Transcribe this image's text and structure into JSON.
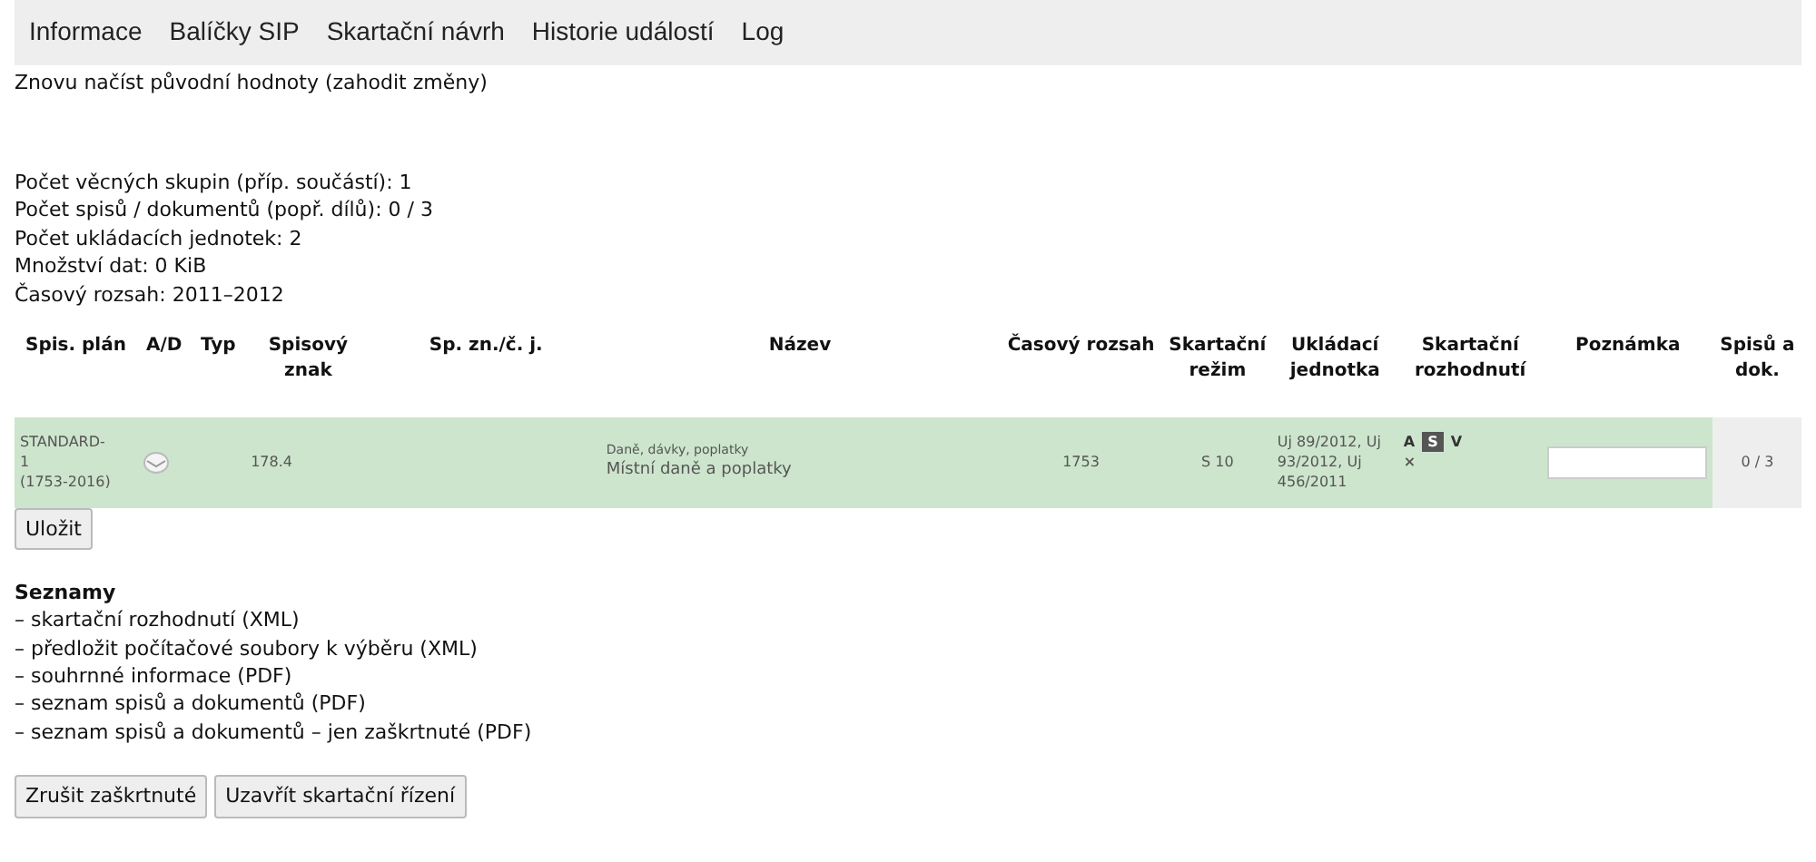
{
  "nav": [
    {
      "label": "Informace"
    },
    {
      "label": "Balíčky SIP"
    },
    {
      "label": "Skartační návrh"
    },
    {
      "label": "Historie událostí"
    },
    {
      "label": "Log"
    }
  ],
  "reload_link": "Znovu načíst původní hodnoty (zahodit změny)",
  "summary": [
    "Počet věcných skupin (příp. součástí): 1",
    "Počet spisů / dokumentů (popř. dílů): 0 / 3",
    "Počet ukládacích jednotek: 2",
    "Množství dat: 0 KiB",
    "Časový rozsah: 2011–2012"
  ],
  "table": {
    "columns": [
      "Spis. plán",
      "A/D",
      "Typ",
      "Spisový znak",
      "Sp. zn./č. j.",
      "Název",
      "Časový rozsah",
      "Skartační režim",
      "Ukládací jednotka",
      "Skartační rozhodnutí",
      "Poznámka",
      "Spisů a dok."
    ],
    "rows": [
      {
        "plan": [
          "STANDARD-",
          "1",
          "(1753-2016)"
        ],
        "spisovy_znak": "178.4",
        "nazev": [
          "Daně, dávky, poplatky",
          "Místní daně a poplatky"
        ],
        "casovy_rozsah": "1753",
        "rezim": "S 10",
        "jednotka": "Uj 89/2012, Uj 93/2012, Uj 456/2011",
        "decision": [
          {
            "label": "A",
            "selected": false
          },
          {
            "label": "S",
            "selected": true
          },
          {
            "label": "V",
            "selected": false
          }
        ],
        "remove": "×",
        "count": "0 / 3"
      }
    ]
  },
  "save_button": "Uložit",
  "lists_title": "Seznamy",
  "lists": [
    "– skartační rozhodnutí (XML)",
    "– předložit počítačové soubory k výběru (XML)",
    "– souhrnné informace (PDF)",
    "– seznam spisů a dokumentů (PDF)",
    "– seznam spisů a dokumentů – jen zaškrtnuté (PDF)"
  ],
  "buttons": [
    "Zrušit zaškrtnuté",
    "Uzavřít skartační řízení"
  ]
}
